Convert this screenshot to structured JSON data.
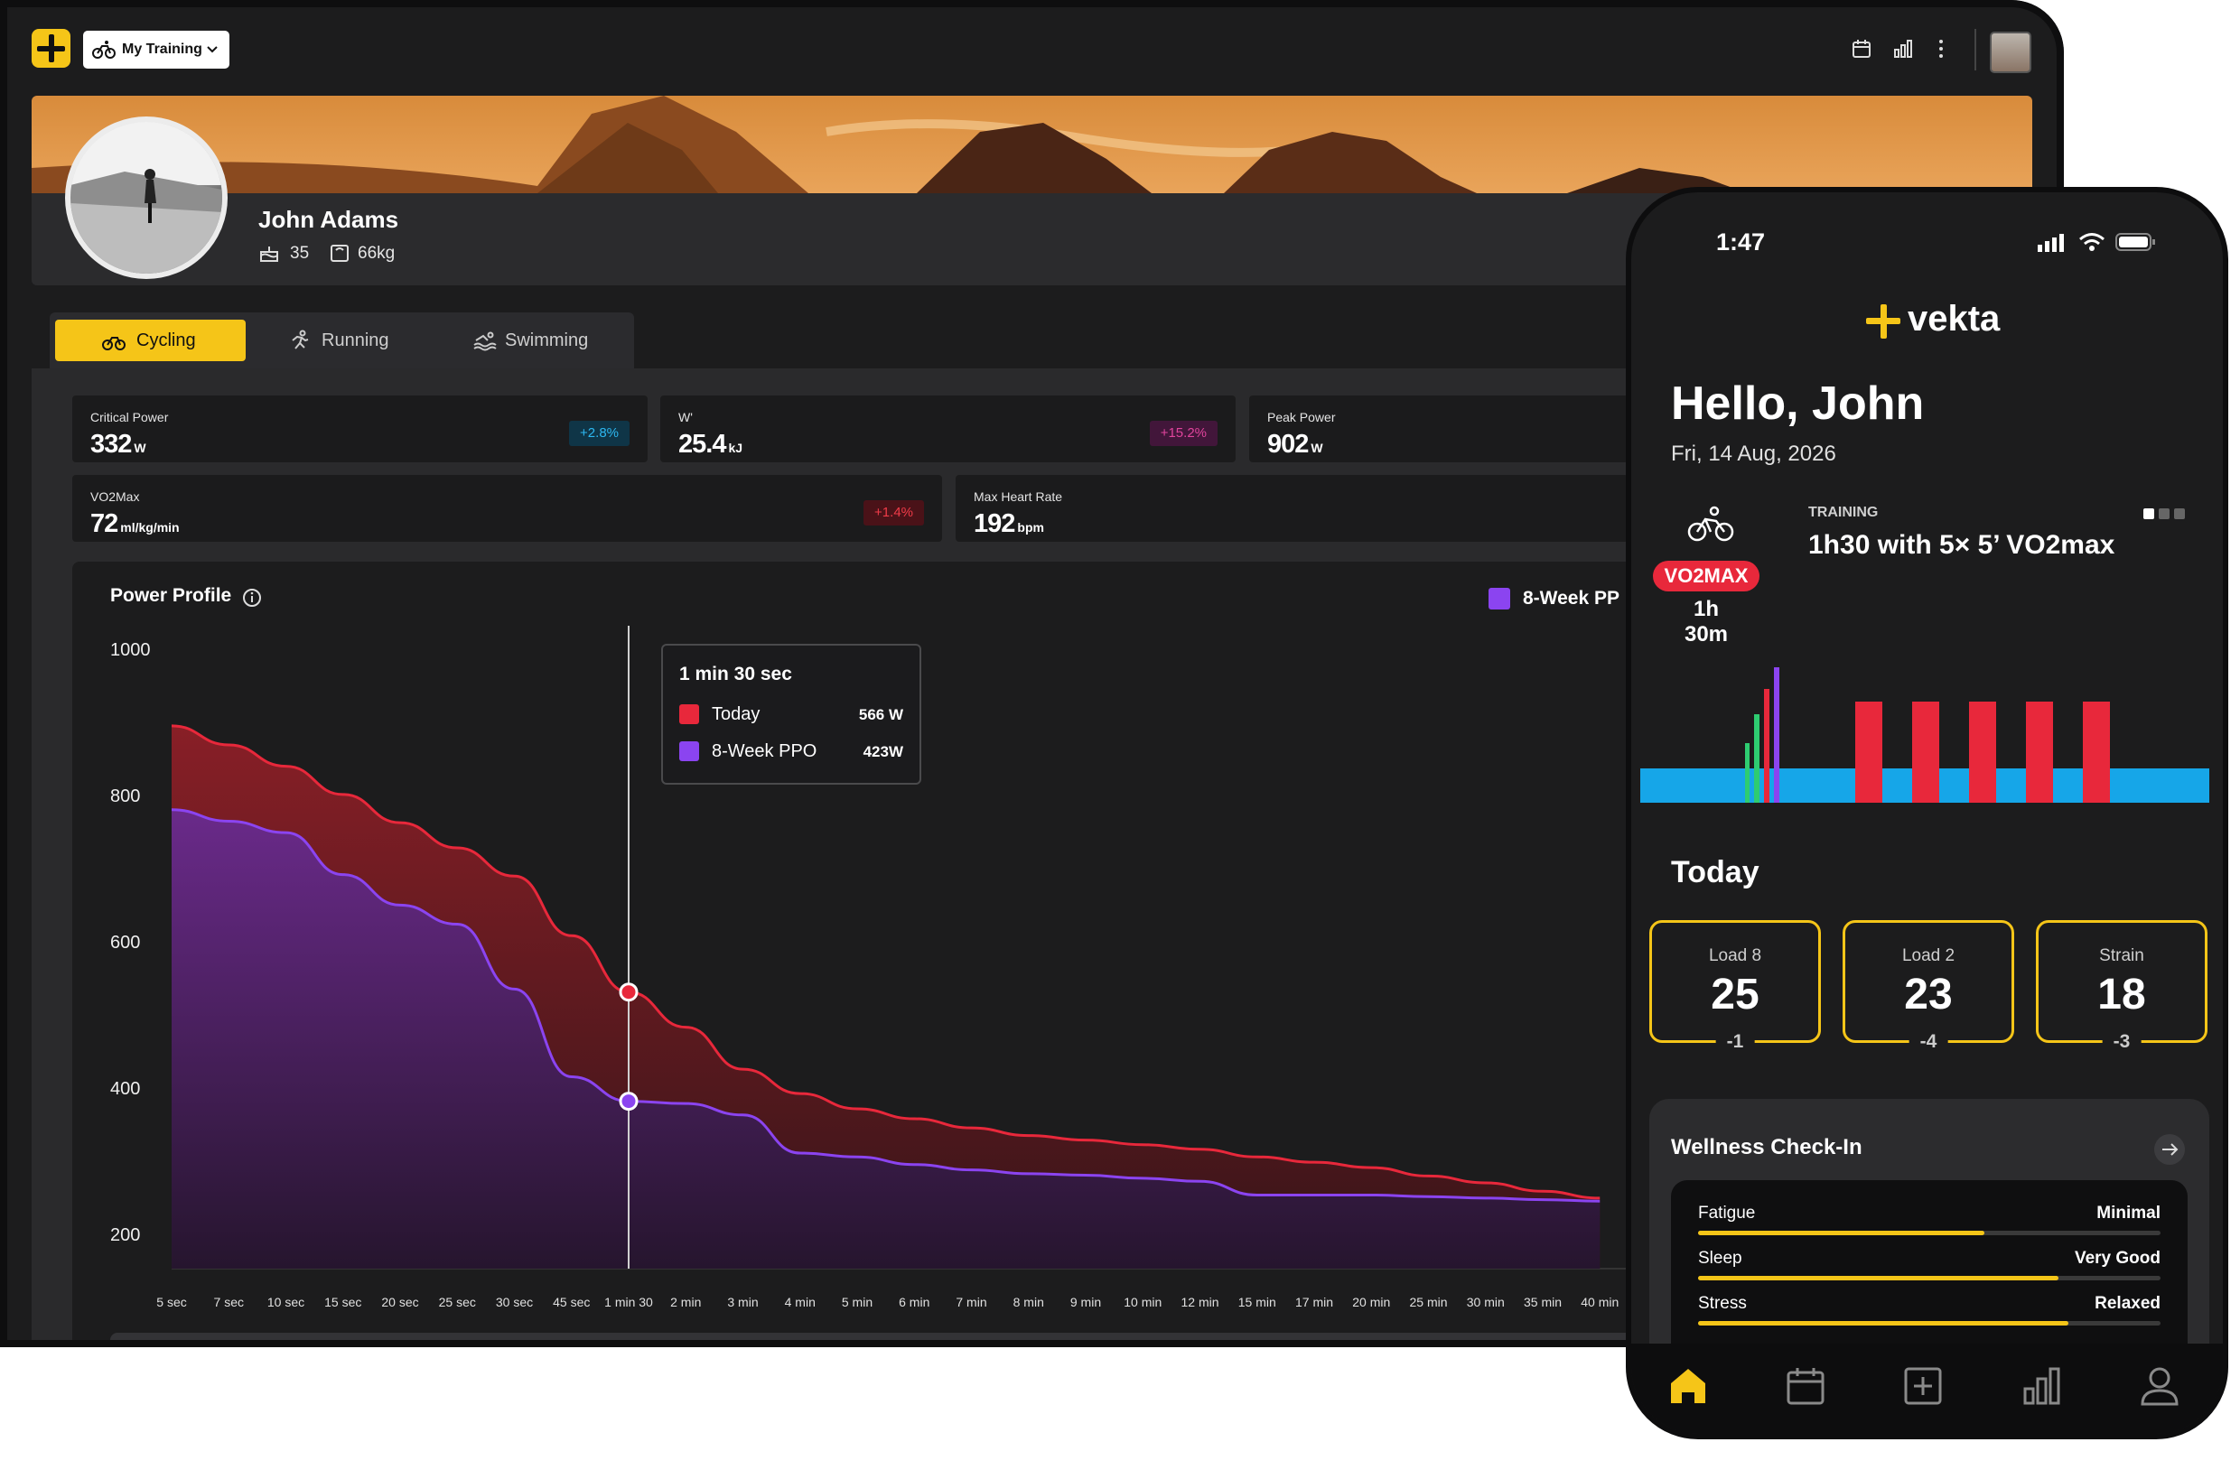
{
  "app": {
    "selector_label": "My Training"
  },
  "profile": {
    "name": "John Adams",
    "age": "35",
    "weight": "66kg"
  },
  "sport_tabs": [
    {
      "label": "Cycling",
      "active": true
    },
    {
      "label": "Running",
      "active": false
    },
    {
      "label": "Swimming",
      "active": false
    }
  ],
  "stats": {
    "critical_power": {
      "label": "Critical Power",
      "value": "332",
      "unit": "W",
      "change": "+2.8%"
    },
    "w_prime": {
      "label": "W'",
      "value": "25.4",
      "unit": "kJ",
      "change": "+15.2%"
    },
    "peak_power": {
      "label": "Peak Power",
      "value": "902",
      "unit": "W"
    },
    "vo2max": {
      "label": "VO2Max",
      "value": "72",
      "unit": "ml/kg/min",
      "change": "+1.4%"
    },
    "max_hr": {
      "label": "Max Heart Rate",
      "value": "192",
      "unit": "bpm"
    }
  },
  "power_profile": {
    "title": "Power Profile",
    "legend_label": "8-Week PP",
    "tooltip": {
      "title": "1 min 30 sec",
      "rows": [
        {
          "label": "Today",
          "value": "566 W",
          "color": "#e8283b"
        },
        {
          "label": "8-Week PPO",
          "value": "423W",
          "color": "#8b44f0"
        }
      ]
    }
  },
  "chart_data": {
    "type": "area",
    "title": "Power Profile",
    "ylim": [
      200,
      1000
    ],
    "yticks": [
      "1000",
      "800",
      "600",
      "400",
      "200"
    ],
    "categories": [
      "5 sec",
      "7 sec",
      "10 sec",
      "15 sec",
      "20 sec",
      "25 sec",
      "30 sec",
      "45 sec",
      "1 min 30",
      "2 min",
      "3 min",
      "4 min",
      "5 min",
      "6 min",
      "7 min",
      "8 min",
      "9 min",
      "10 min",
      "12 min",
      "15 min",
      "17 min",
      "20 min",
      "25 min",
      "30 min",
      "35 min",
      "40 min"
    ],
    "series": [
      {
        "name": "Today",
        "color": "#e8283b",
        "values": [
          915,
          890,
          862,
          825,
          788,
          755,
          718,
          640,
          566,
          520,
          465,
          433,
          413,
          400,
          388,
          378,
          372,
          366,
          360,
          350,
          343,
          336,
          325,
          316,
          305,
          296
        ]
      },
      {
        "name": "8-Week PPO",
        "color": "#8b44f0",
        "values": [
          805,
          790,
          775,
          720,
          680,
          655,
          570,
          455,
          423,
          420,
          405,
          355,
          350,
          340,
          333,
          328,
          326,
          322,
          318,
          300,
          300,
          300,
          298,
          296,
          294,
          292
        ]
      }
    ]
  },
  "phone": {
    "time": "1:47",
    "brand": "vekta",
    "greeting": "Hello, John",
    "date": "Fri, 14 Aug, 2026",
    "training_label": "TRAINING",
    "training_title": "1h30 with 5× 5’ VO2max",
    "badge": "VO2MAX",
    "duration": "1h 30m",
    "today_title": "Today",
    "loads": [
      {
        "label": "Load 8",
        "value": "25",
        "delta": "-1"
      },
      {
        "label": "Load 2",
        "value": "23",
        "delta": "-4"
      },
      {
        "label": "Strain",
        "value": "18",
        "delta": "-3"
      }
    ],
    "wellness_title": "Wellness Check-In",
    "wellness": [
      {
        "label": "Fatigue",
        "value": "Minimal",
        "level": 0.62
      },
      {
        "label": "Sleep",
        "value": "Very Good",
        "level": 0.78
      },
      {
        "label": "Stress",
        "value": "Relaxed",
        "level": 0.8
      }
    ]
  },
  "colors": {
    "accent": "#f5c518",
    "today": "#e8283b",
    "ppo": "#8b44f0",
    "z2": "#16a6e8"
  },
  "icons": [
    "plus-logo-icon",
    "bike-icon",
    "chevron-down-icon",
    "calendar-icon",
    "chart-icon",
    "more-icon",
    "cake-icon",
    "scale-icon",
    "running-icon",
    "swimming-icon",
    "info-icon",
    "arrow-right-icon",
    "home-icon",
    "add-icon",
    "profile-icon",
    "signal-icon",
    "wifi-icon",
    "battery-icon"
  ]
}
